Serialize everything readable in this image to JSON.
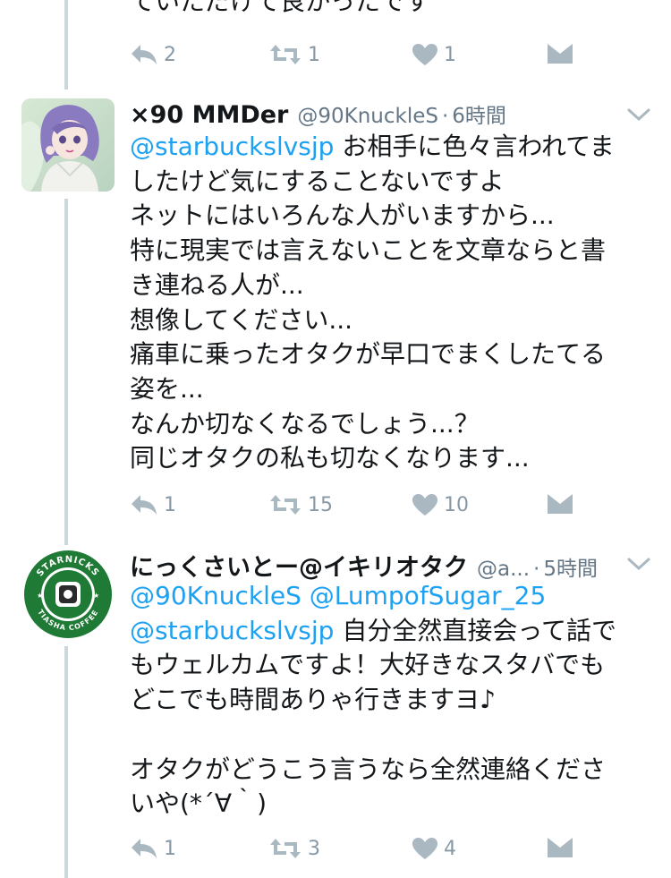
{
  "top_fragment": {
    "text": "ていただけて良かったです",
    "actions": {
      "reply": "2",
      "retweet": "1",
      "like": "1"
    }
  },
  "tweets": [
    {
      "name": "×90 MMDer",
      "handle": "@90KnuckleS",
      "sep": "·",
      "time": "6時間",
      "mention_line1": "@starbuckslvsjp",
      "text_after_mention": " お相手に色々言われてま\nしたけど気にすることないですよ\nネットにはいろんな人がいますから...\n特に現実では言えないことを文章ならと書\nき連ねる人が...\n想像してください...\n痛車に乗ったオタクが早口でまくしたてる\n姿を...\nなんか切なくなるでしょう...？\n同じオタクの私も切なくなります...",
      "actions": {
        "reply": "1",
        "retweet": "15",
        "like": "10"
      }
    },
    {
      "name": "にっくさいとー@イキリオタク",
      "handle": "@a...",
      "sep": "·",
      "time": "5時間",
      "mention_a": "@90KnuckleS",
      "mention_b": "@LumpofSugar_25",
      "mention_c": "@starbuckslvsjp",
      "text_after_mention": " 自分全然直接会って話で\nもウェルカムですよ！大好きなスタバでも\nどこでも時間ありゃ行きますヨ♪\n\nオタクがどうこう言うなら全然連絡くださ\nいや(*´∀｀)",
      "avatar_ring_text": "STARNICKS · TIASHA COFFEE",
      "actions": {
        "reply": "1",
        "retweet": "3",
        "like": "4"
      }
    }
  ],
  "icons": {
    "reply": "reply-icon",
    "retweet": "retweet-icon",
    "like": "heart-icon",
    "dm": "envelope-icon",
    "more": "chevron-down-icon"
  },
  "colors": {
    "link": "#1da1f2",
    "muted": "#657786",
    "action": "#aab8c2",
    "thread_line": "#ccd6dd",
    "starnicks_green": "#1e7a34"
  }
}
